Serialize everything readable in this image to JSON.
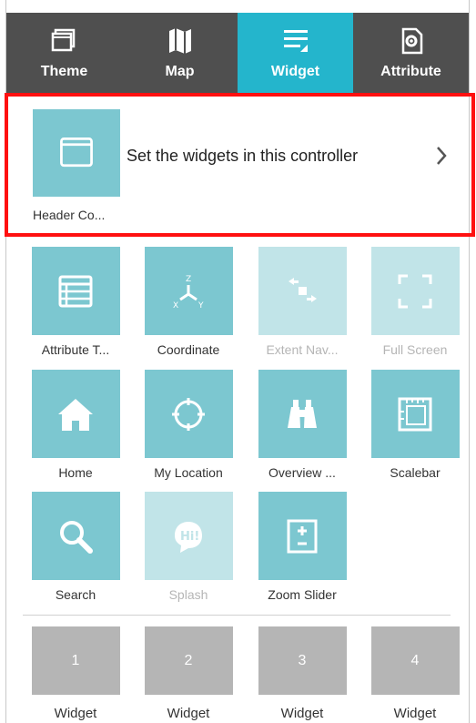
{
  "tabs": [
    {
      "label": "Theme",
      "icon": "theme-icon",
      "active": false
    },
    {
      "label": "Map",
      "icon": "map-icon",
      "active": false
    },
    {
      "label": "Widget",
      "icon": "widget-icon",
      "active": true
    },
    {
      "label": "Attribute",
      "icon": "attribute-icon",
      "active": false
    }
  ],
  "controller": {
    "tile_label": "Header Co...",
    "description": "Set the widgets in this controller",
    "icon": "window-icon"
  },
  "widgets": [
    {
      "label": "Attribute T...",
      "icon": "table-icon",
      "enabled": true
    },
    {
      "label": "Coordinate",
      "icon": "coordinate-icon",
      "enabled": true
    },
    {
      "label": "Extent Nav...",
      "icon": "extent-navigate-icon",
      "enabled": false
    },
    {
      "label": "Full Screen",
      "icon": "fullscreen-icon",
      "enabled": false
    },
    {
      "label": "Home",
      "icon": "home-icon",
      "enabled": true
    },
    {
      "label": "My Location",
      "icon": "location-icon",
      "enabled": true
    },
    {
      "label": "Overview ...",
      "icon": "binoculars-icon",
      "enabled": true
    },
    {
      "label": "Scalebar",
      "icon": "scalebar-icon",
      "enabled": true
    },
    {
      "label": "Search",
      "icon": "search-icon",
      "enabled": true
    },
    {
      "label": "Splash",
      "icon": "splash-icon",
      "enabled": false
    },
    {
      "label": "Zoom Slider",
      "icon": "zoom-slider-icon",
      "enabled": true
    }
  ],
  "placeholders": [
    {
      "number": "1",
      "label": "Widget"
    },
    {
      "number": "2",
      "label": "Widget"
    },
    {
      "number": "3",
      "label": "Widget"
    },
    {
      "number": "4",
      "label": "Widget"
    }
  ],
  "colors": {
    "tab_bar": "#4f4f4f",
    "active_tab": "#24b5cc",
    "tile": "#7cc7d0",
    "tile_disabled": "#c1e4e8",
    "placeholder": "#b5b5b5",
    "highlight": "#ff1010"
  }
}
